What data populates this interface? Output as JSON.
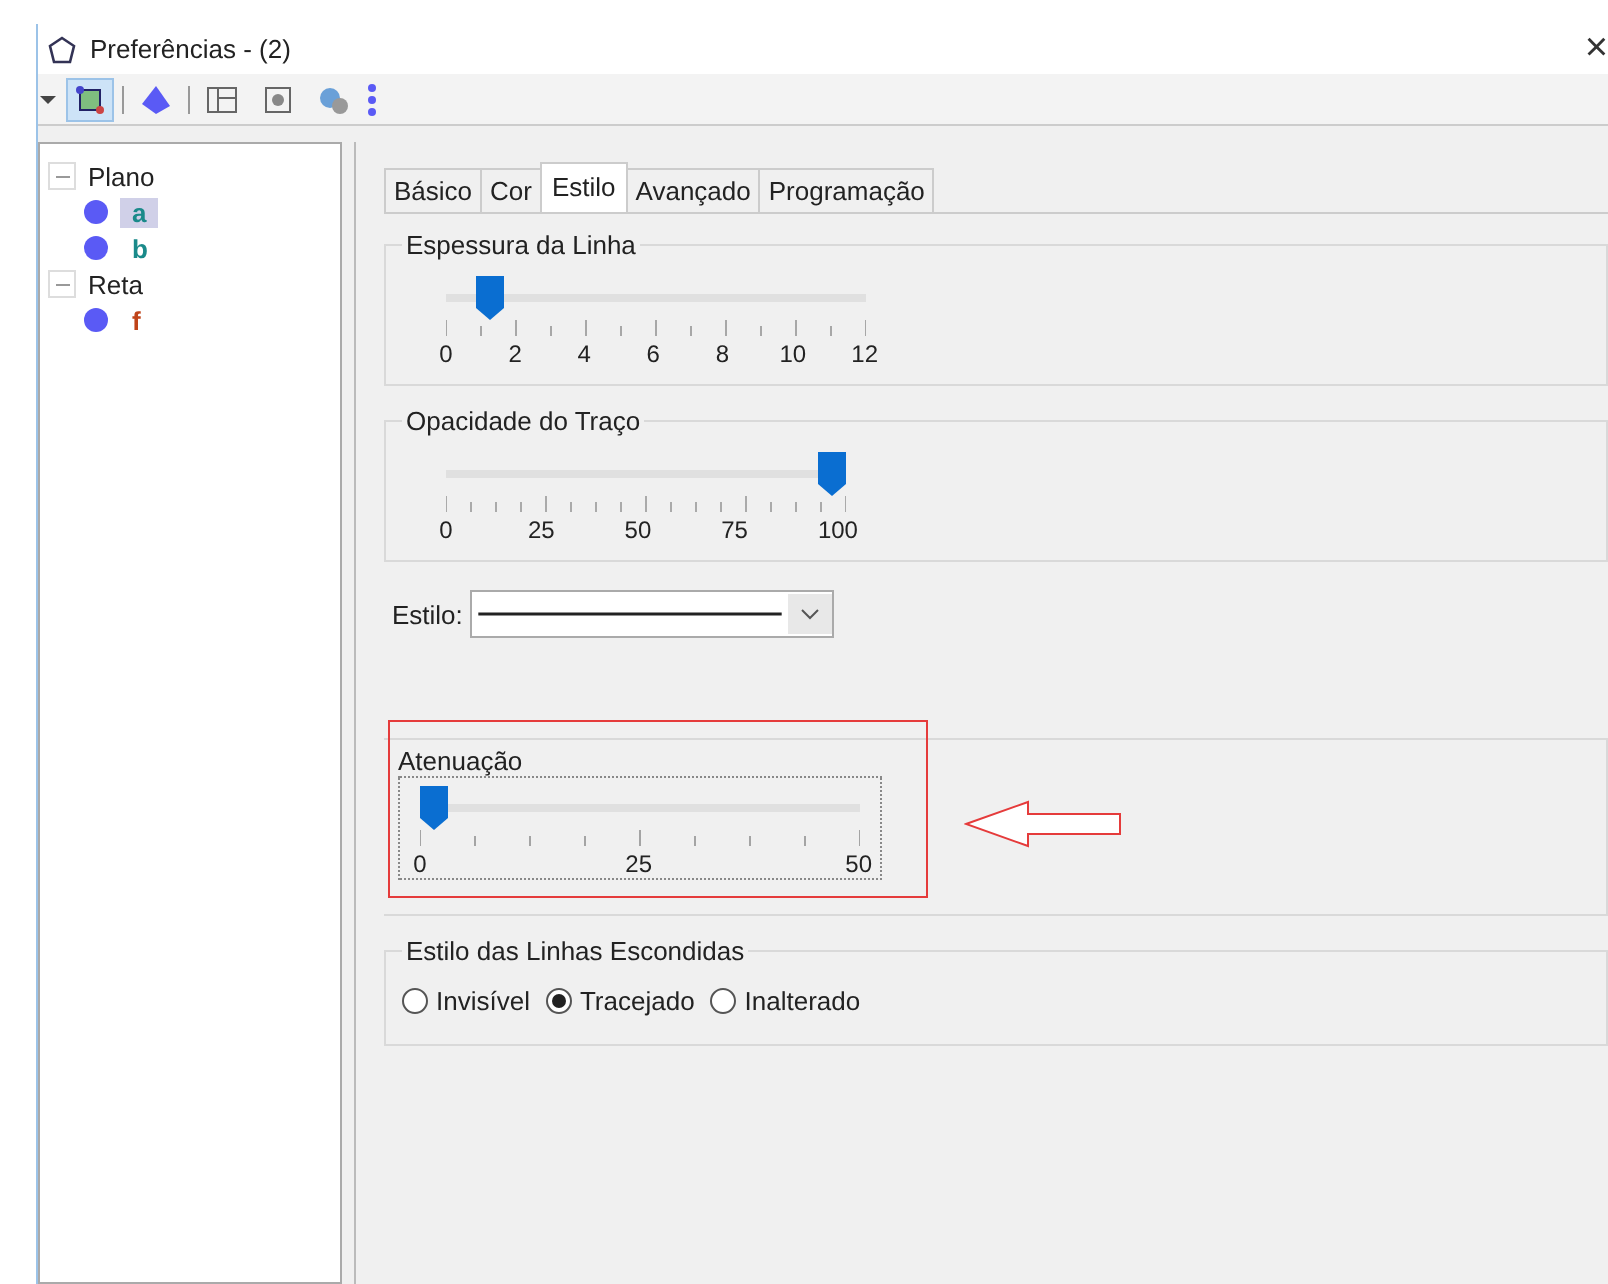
{
  "window": {
    "title": "Preferências - (2)",
    "close": "×"
  },
  "toolbar": [
    {
      "kind": "graphics",
      "selected": true
    },
    {
      "kind": "pyramid",
      "selected": false
    },
    {
      "kind": "layout",
      "selected": false
    },
    {
      "kind": "properties",
      "selected": false
    },
    {
      "kind": "gears",
      "selected": false
    }
  ],
  "tree": [
    {
      "label": "Plano",
      "expanded": true,
      "children": [
        {
          "label": "a",
          "selected": true,
          "color": "#1a8a8a"
        },
        {
          "label": "b",
          "selected": false,
          "color": "#1a8a8a"
        }
      ]
    },
    {
      "label": "Reta",
      "expanded": true,
      "children": [
        {
          "label": "f",
          "selected": false,
          "color": "#c0441a"
        }
      ]
    }
  ],
  "tabs": [
    {
      "label": "Básico",
      "selected": false
    },
    {
      "label": "Cor",
      "selected": false
    },
    {
      "label": "Estilo",
      "selected": true
    },
    {
      "label": "Avançado",
      "selected": false
    },
    {
      "label": "Programação",
      "selected": false
    }
  ],
  "sections": [
    {
      "kind": "slider",
      "title": "Espessura da Linha",
      "level": 0.077,
      "ticks": [
        "0",
        "2",
        "4",
        "6",
        "8",
        "10",
        "12"
      ],
      "highlighted": false
    },
    {
      "kind": "slider",
      "title": "Opacidade do Traço",
      "level": 1,
      "ticks": [
        "0",
        "25",
        "50",
        "75",
        "100"
      ],
      "highlighted": false
    },
    {
      "kind": "dropdown",
      "label": "Estilo:"
    },
    {
      "kind": "slider",
      "title": "Atenuação",
      "level": 0,
      "ticks": [
        "0",
        "25",
        "50"
      ],
      "highlighted": true
    },
    {
      "kind": "radios",
      "title": "Estilo das Linhas Escondidas",
      "options": [
        {
          "label": "Invisível",
          "selected": false
        },
        {
          "label": "Tracejado",
          "selected": true
        },
        {
          "label": "Inalterado",
          "selected": false
        }
      ]
    }
  ]
}
